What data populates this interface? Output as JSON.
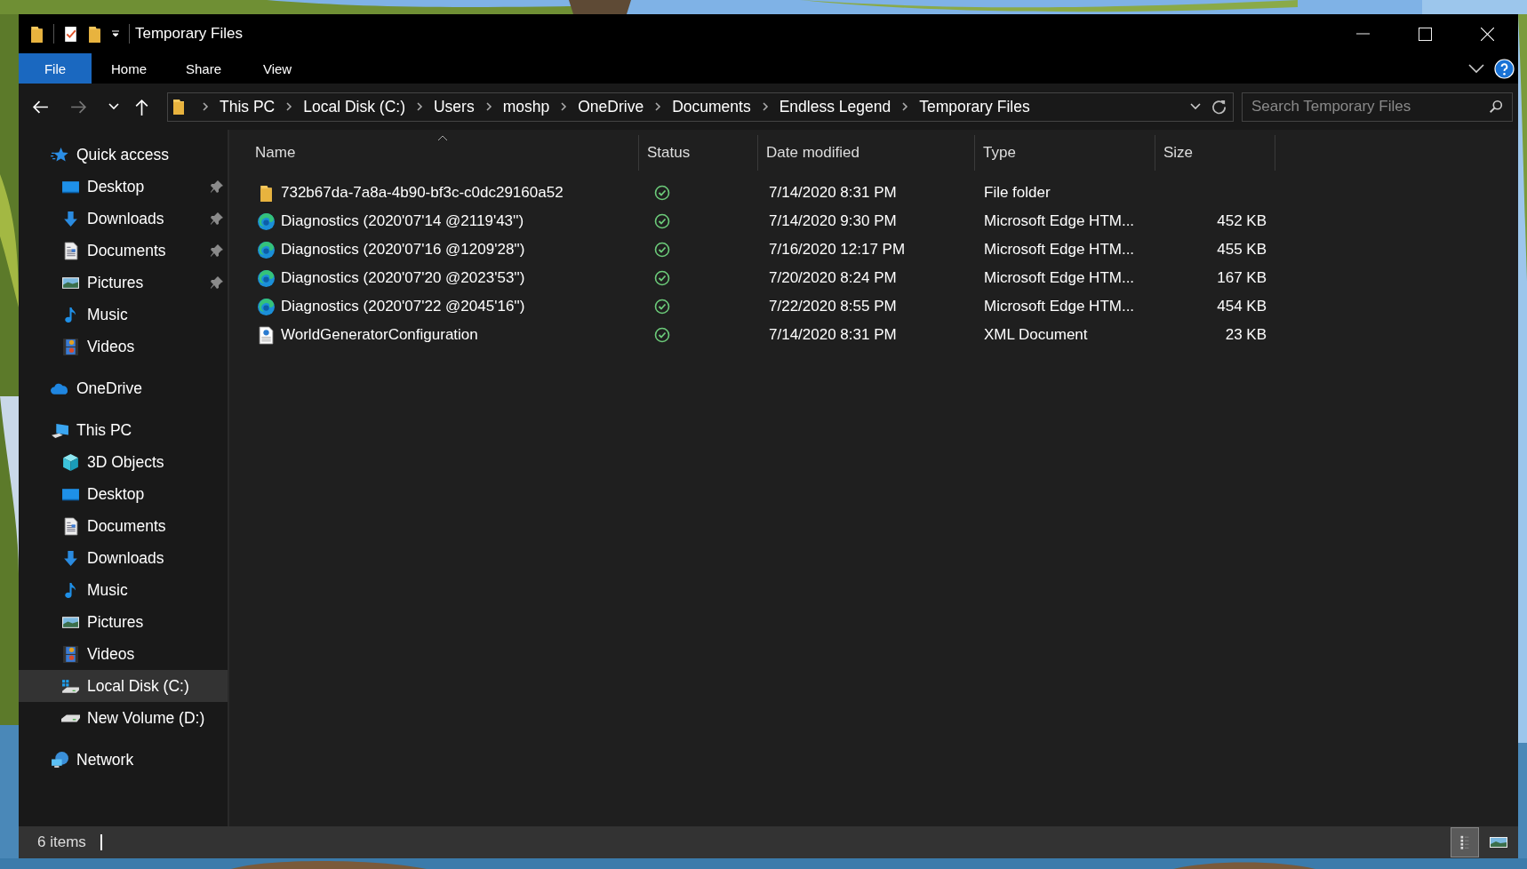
{
  "window": {
    "title": "Temporary Files"
  },
  "ribbon_tabs": [
    {
      "label": "File",
      "selected": true
    },
    {
      "label": "Home",
      "selected": false
    },
    {
      "label": "Share",
      "selected": false
    },
    {
      "label": "View",
      "selected": false
    }
  ],
  "navigation": {
    "forward_disabled": true
  },
  "address_bar": {
    "segments": [
      "This PC",
      "Local Disk (C:)",
      "Users",
      "moshp",
      "OneDrive",
      "Documents",
      "Endless Legend",
      "Temporary Files"
    ]
  },
  "search": {
    "placeholder": "Search Temporary Files"
  },
  "sidebar": {
    "items": [
      {
        "label": "Quick access",
        "kind": "star",
        "selected": false,
        "children": [
          {
            "label": "Desktop",
            "kind": "desktop",
            "pinned": true,
            "selected": false
          },
          {
            "label": "Downloads",
            "kind": "downloads",
            "pinned": true,
            "selected": false
          },
          {
            "label": "Documents",
            "kind": "documents",
            "pinned": true,
            "selected": false
          },
          {
            "label": "Pictures",
            "kind": "pictures",
            "pinned": true,
            "selected": false
          },
          {
            "label": "Music",
            "kind": "music",
            "pinned": false,
            "selected": false
          },
          {
            "label": "Videos",
            "kind": "videos",
            "pinned": false,
            "selected": false
          }
        ]
      },
      {
        "label": "OneDrive",
        "kind": "cloud",
        "selected": false
      },
      {
        "label": "This PC",
        "kind": "pc",
        "selected": false,
        "children": [
          {
            "label": "3D Objects",
            "kind": "cube",
            "pinned": false,
            "selected": false
          },
          {
            "label": "Desktop",
            "kind": "desktop",
            "pinned": false,
            "selected": false
          },
          {
            "label": "Documents",
            "kind": "documents",
            "pinned": false,
            "selected": false
          },
          {
            "label": "Downloads",
            "kind": "downloads",
            "pinned": false,
            "selected": false
          },
          {
            "label": "Music",
            "kind": "music",
            "pinned": false,
            "selected": false
          },
          {
            "label": "Pictures",
            "kind": "pictures",
            "pinned": false,
            "selected": false
          },
          {
            "label": "Videos",
            "kind": "videos",
            "pinned": false,
            "selected": false
          },
          {
            "label": "Local Disk (C:)",
            "kind": "system-drive",
            "pinned": false,
            "selected": true
          },
          {
            "label": "New Volume (D:)",
            "kind": "drive",
            "pinned": false,
            "selected": false
          }
        ]
      },
      {
        "label": "Network",
        "kind": "network",
        "selected": false
      }
    ]
  },
  "table": {
    "columns": [
      "Name",
      "Status",
      "Date modified",
      "Type",
      "Size"
    ],
    "rows": [
      {
        "kind": "folder",
        "name": "732b67da-7a8a-4b90-bf3c-c0dc29160a52",
        "date": "7/14/2020 8:31 PM",
        "type": "File folder"
      },
      {
        "kind": "edge",
        "name": "Diagnostics (2020'07'14 @2119'43'')",
        "date": "7/14/2020 9:30 PM",
        "type": "Microsoft Edge HTM...",
        "size": "452 KB"
      },
      {
        "kind": "edge",
        "name": "Diagnostics (2020'07'16 @1209'28'')",
        "date": "7/16/2020 12:17 PM",
        "type": "Microsoft Edge HTM...",
        "size": "455 KB"
      },
      {
        "kind": "edge",
        "name": "Diagnostics (2020'07'20 @2023'53'')",
        "date": "7/20/2020 8:24 PM",
        "type": "Microsoft Edge HTM...",
        "size": "167 KB"
      },
      {
        "kind": "edge",
        "name": "Diagnostics (2020'07'22 @2045'16'')",
        "date": "7/22/2020 8:55 PM",
        "type": "Microsoft Edge HTM...",
        "size": "454 KB"
      },
      {
        "kind": "xml",
        "name": "WorldGeneratorConfiguration",
        "date": "7/14/2020 8:31 PM",
        "type": "XML Document",
        "size": "23 KB"
      }
    ]
  },
  "status_bar": {
    "item_count": "6 items",
    "view_modes": [
      {
        "kind": "details",
        "selected": true
      },
      {
        "kind": "large-icons",
        "selected": false
      }
    ]
  }
}
